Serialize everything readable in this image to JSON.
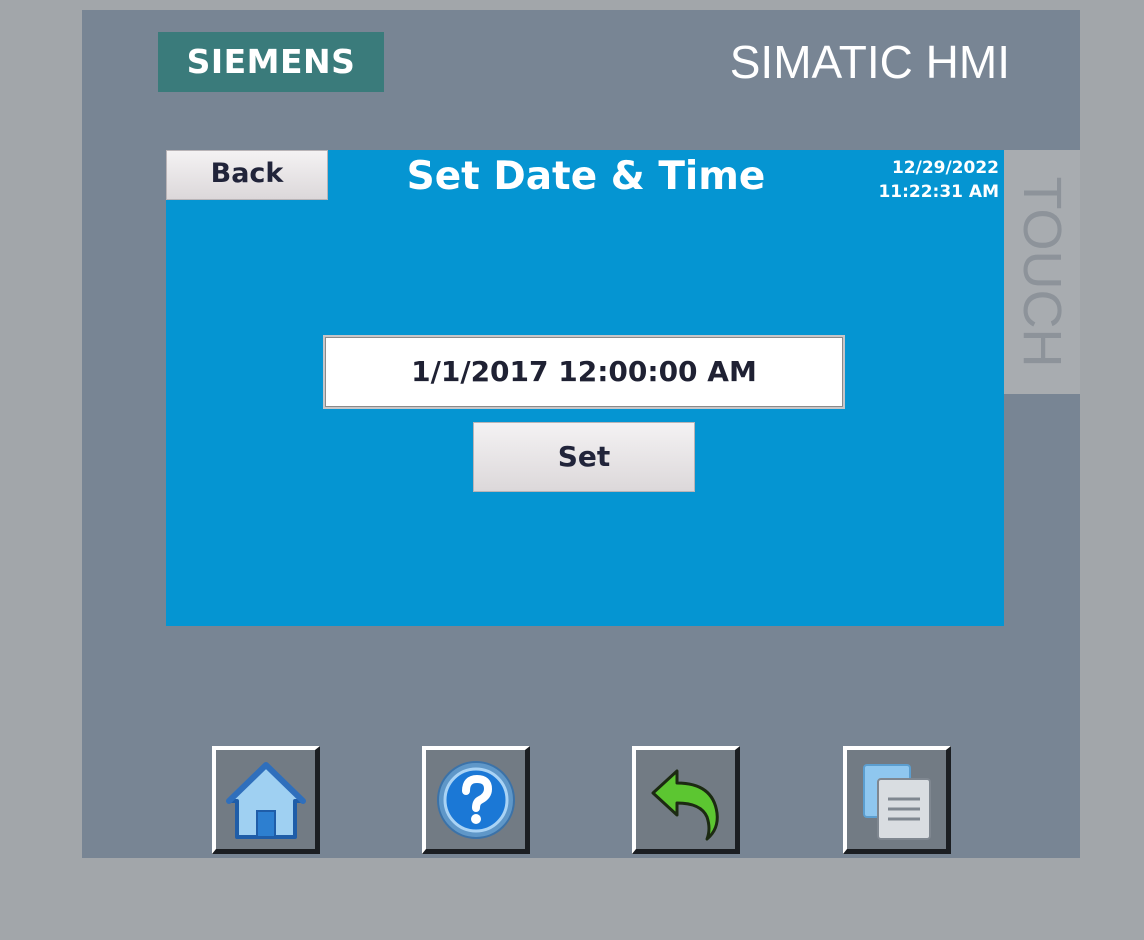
{
  "device": {
    "brand": "SIEMENS",
    "model": "SIMATIC HMI",
    "side_label": "TOUCH"
  },
  "screen": {
    "title": "Set Date & Time",
    "back_label": "Back",
    "clock": {
      "date": "12/29/2022",
      "time": "11:22:31 AM"
    },
    "datetime_field": {
      "value": "1/1/2017 12:00:00 AM"
    },
    "set_label": "Set",
    "background_color": "#0595d2"
  },
  "function_keys": [
    {
      "name": "home",
      "icon": "home-icon"
    },
    {
      "name": "help",
      "icon": "help-icon"
    },
    {
      "name": "return",
      "icon": "return-arrow-icon"
    },
    {
      "name": "screens",
      "icon": "screens-icon"
    }
  ],
  "colors": {
    "bezel": "#788594",
    "logo_background": "#3a7b7b",
    "screen": "#0595d2",
    "button": "#e6e3e4"
  }
}
